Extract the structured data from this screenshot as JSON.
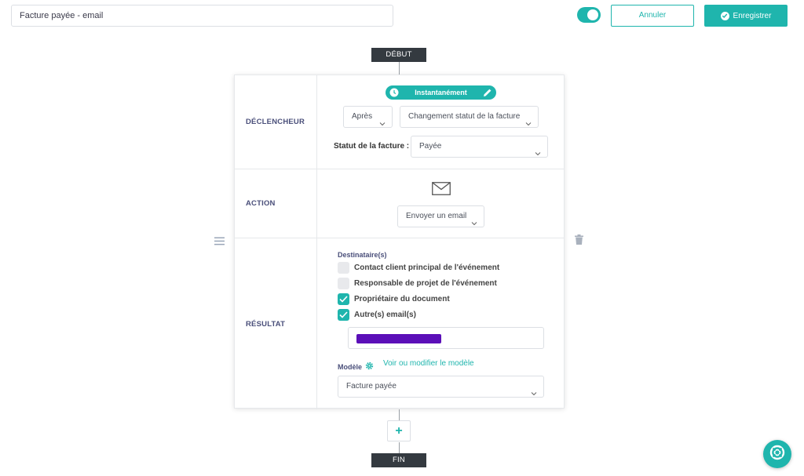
{
  "header": {
    "automation_name": "Facture payée - email",
    "toggle_state": "on",
    "cancel_label": "Annuler",
    "save_label": "Enregistrer"
  },
  "flow": {
    "start_label": "DÉBUT",
    "end_label": "FIN",
    "add_label": "+"
  },
  "trigger": {
    "section_label": "DÉCLENCHEUR",
    "timing_pill": "Instantanément",
    "when_select": "Après",
    "event_select": "Changement statut de la facture",
    "status_label": "Statut de la facture :",
    "status_select": "Payée"
  },
  "action": {
    "section_label": "ACTION",
    "icon": "envelope-icon",
    "action_select": "Envoyer un email"
  },
  "result": {
    "section_label": "RÉSULTAT",
    "recipients_label": "Destinataire(s)",
    "recipients": [
      {
        "label": "Contact client principal de l'événement",
        "checked": false
      },
      {
        "label": "Responsable de projet de l'événement",
        "checked": false
      },
      {
        "label": "Propriétaire du document",
        "checked": true
      },
      {
        "label": "Autre(s) email(s)",
        "checked": true
      }
    ],
    "model_label": "Modèle",
    "model_link": "Voir ou modifier le modèle",
    "model_select": "Facture payée"
  },
  "colors": {
    "accent": "#1fb5ad",
    "dark_tag": "#343a40",
    "section_label": "#4a4f7a",
    "redaction": "#5b0fb8"
  }
}
